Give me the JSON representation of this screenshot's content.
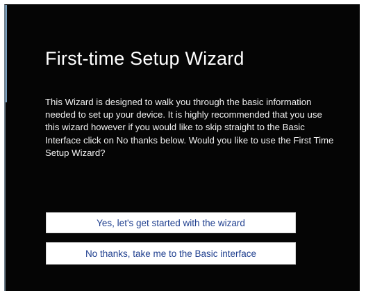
{
  "wizard": {
    "title": "First-time Setup Wizard",
    "description": "This Wizard is designed to walk you through the basic information needed to set up your device. It is highly recommended that you use this wizard however if you would like to skip straight to the Basic Interface click on No thanks below. Would you like to use the First Time Setup Wizard?",
    "yes_button_label": "Yes, let's get started with the wizard",
    "no_button_label": "No thanks, take me to the Basic interface"
  },
  "colors": {
    "background": "#050505",
    "title_text": "#ffffff",
    "body_text": "#f2f2f2",
    "button_background": "#ffffff",
    "button_text": "#1f3f8f"
  }
}
